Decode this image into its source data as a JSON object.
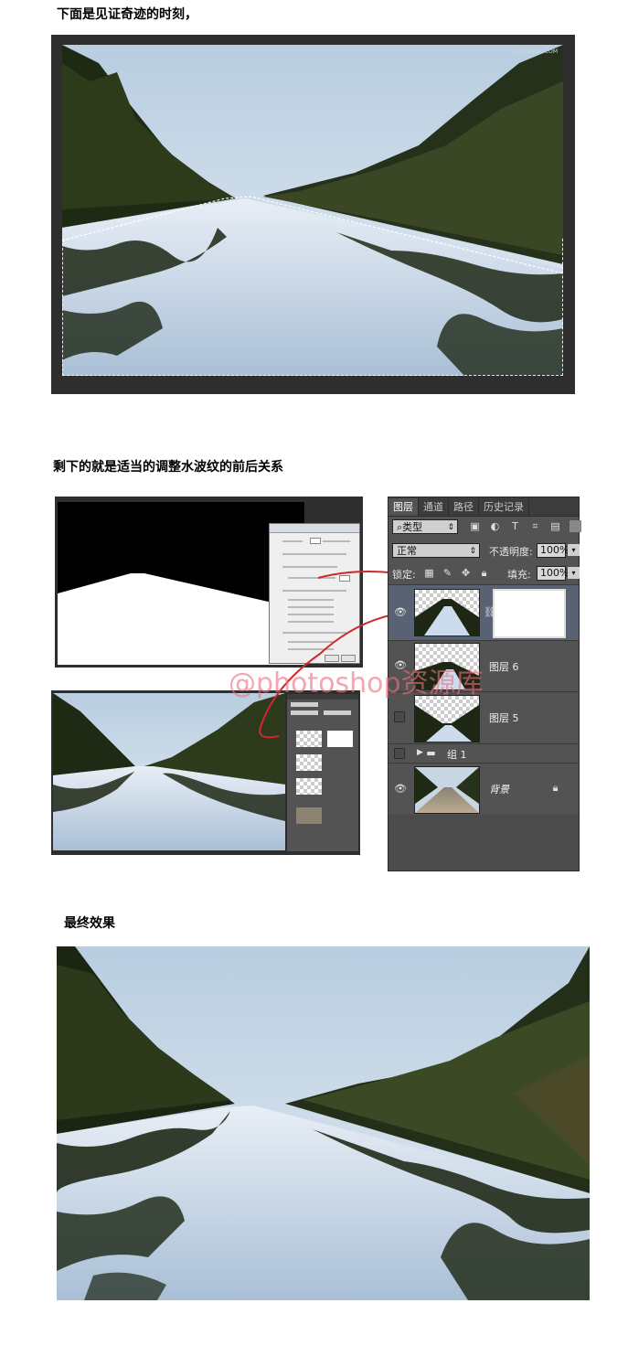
{
  "headings": {
    "section1": "下面是见证奇迹的时刻，",
    "section2": "剩下的就是适当的调整水波纹的前后关系",
    "section3": "最终效果"
  },
  "screenshot1": {
    "watermark_small": "QUHUANG.COM"
  },
  "watermark": "@photoshop资源库",
  "layers_panel": {
    "tabs": [
      "图层",
      "通道",
      "路径",
      "历史记录"
    ],
    "filter_kind": "类型",
    "blend_mode": "正常",
    "opacity_label": "不透明度:",
    "opacity_value": "100%",
    "lock_label": "锁定:",
    "fill_label": "填充:",
    "fill_value": "100%",
    "layers": [
      {
        "name": "",
        "visible": true,
        "has_mask": true
      },
      {
        "name": "图层 6",
        "visible": true
      },
      {
        "name": "图层 5",
        "visible": false
      },
      {
        "name": "组 1",
        "visible": false,
        "group": true
      },
      {
        "name": "背景",
        "visible": true,
        "locked": true
      }
    ]
  },
  "colors": {
    "panel_bg": "#535353",
    "frame_bg": "#2e2e2e",
    "watermark": "#ec7080",
    "annotation": "#d0282c"
  }
}
